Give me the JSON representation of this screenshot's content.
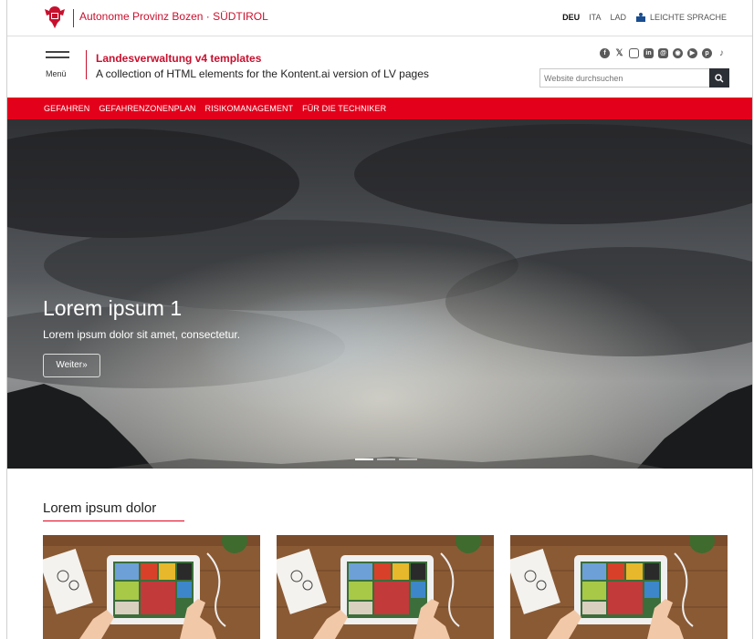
{
  "topbar": {
    "org_name": "Autonome Provinz Bozen · SÜDTIROL",
    "languages": [
      "DEU",
      "ITA",
      "LAD"
    ],
    "active_language": "DEU",
    "easy_language": "LEICHTE SPRACHE"
  },
  "header": {
    "menu_label": "Menü",
    "site_title": "Landesverwaltung v4 templates",
    "site_subtitle": "A collection of HTML elements for the Kontent.ai version of LV pages",
    "search_placeholder": "Website durchsuchen",
    "social_icons": [
      "facebook-icon",
      "x-icon",
      "instagram-icon",
      "linkedin-icon",
      "threads-icon",
      "whatsapp-icon",
      "youtube-icon",
      "pinterest-icon",
      "tiktok-icon"
    ]
  },
  "nav": {
    "items": [
      "GEFAHREN",
      "GEFAHRENZONENPLAN",
      "RISIKOMANAGEMENT",
      "FÜR DIE TECHNIKER"
    ]
  },
  "hero": {
    "title": "Lorem ipsum 1",
    "text": "Lorem ipsum dolor sit amet, consectetur.",
    "button_label": "Weiter»",
    "slides_total": 3,
    "active_slide": 1
  },
  "section": {
    "title": "Lorem ipsum dolor",
    "cards_count": 3
  },
  "colors": {
    "brand_red": "#e3001b",
    "dark": "#2b2f36"
  }
}
